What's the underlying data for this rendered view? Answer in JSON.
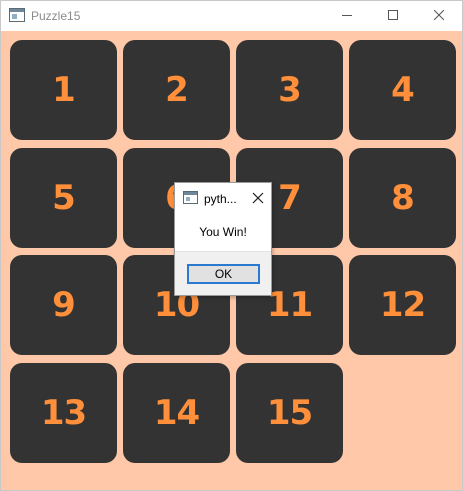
{
  "window": {
    "title": "Puzzle15",
    "icon": "app-window-icon",
    "controls": [
      "minimize-icon",
      "maximize-icon",
      "close-icon"
    ]
  },
  "board": {
    "background_color": "#ffc8a9",
    "tile_color": "#333333",
    "number_color": "#ff8f3a",
    "tiles": [
      "1",
      "2",
      "3",
      "4",
      "5",
      "6",
      "7",
      "8",
      "9",
      "10",
      "11",
      "12",
      "13",
      "14",
      "15"
    ]
  },
  "dialog": {
    "title": "pyth...",
    "message": "You Win!",
    "ok_label": "OK"
  }
}
